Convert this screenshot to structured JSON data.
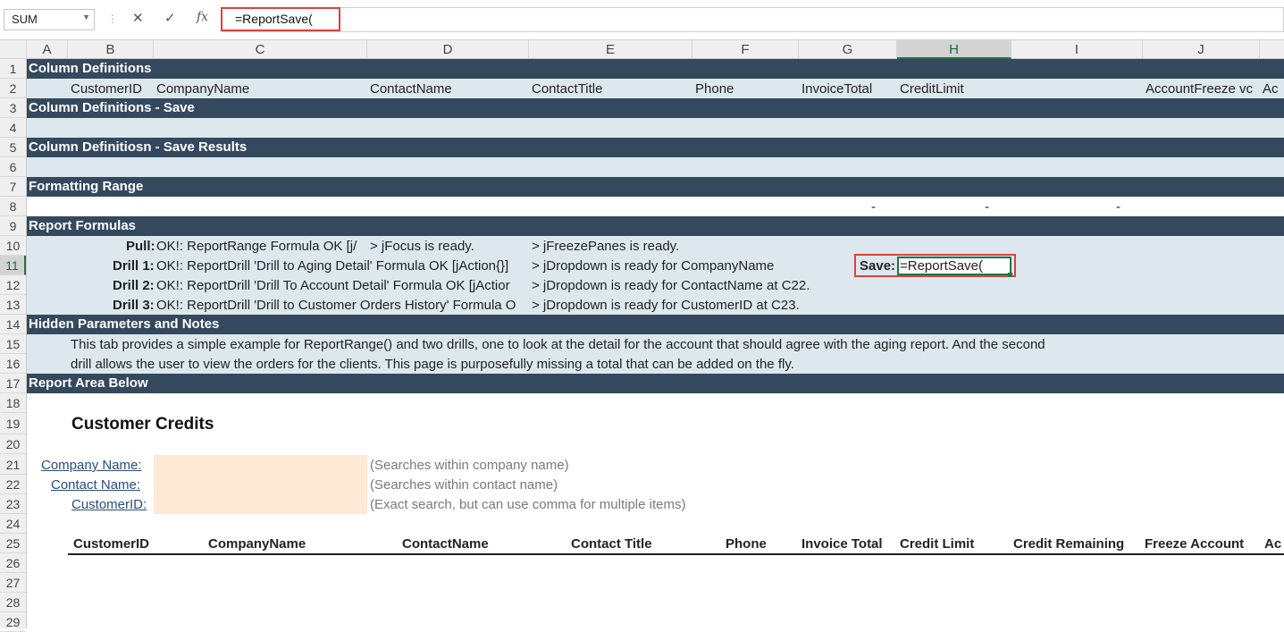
{
  "formula_bar": {
    "name_box": "SUM",
    "formula": "=ReportSave(",
    "icons": [
      "cancel-icon",
      "enter-check-icon",
      "insert-function-icon"
    ]
  },
  "columns": [
    "A",
    "B",
    "C",
    "D",
    "E",
    "F",
    "G",
    "H",
    "I",
    "J"
  ],
  "selected_column": "H",
  "rows": [
    "1",
    "2",
    "3",
    "4",
    "5",
    "6",
    "7",
    "8",
    "9",
    "10",
    "11",
    "12",
    "13",
    "14",
    "15",
    "16",
    "17",
    "18",
    "19",
    "20",
    "21",
    "22",
    "23",
    "24",
    "25",
    "26",
    "27",
    "28",
    "29"
  ],
  "selected_row": "11",
  "sections": {
    "col_defs": "Column Definitions",
    "col_defs_save": "Column Definitions - Save",
    "col_defs_save_results": "Column Definitiosn - Save Results",
    "formatting_range": "Formatting Range",
    "report_formulas": "Report Formulas",
    "hidden_params": "Hidden Parameters and Notes",
    "report_area": "Report Area Below"
  },
  "col_def_headers": {
    "b": "CustomerID",
    "c": "CompanyName",
    "d": "ContactName",
    "e": "ContactTitle",
    "f": "Phone",
    "g": "InvoiceTotal",
    "h": "CreditLimit",
    "j": "AccountFreeze vc",
    "k": "Ac"
  },
  "formatting_row": {
    "g": "-",
    "h": "-",
    "i": "-"
  },
  "formulas": {
    "pull_label": "Pull:",
    "pull_c": "OK!: ReportRange Formula OK [j/",
    "pull_d": "> jFocus is ready.",
    "pull_e": "> jFreezePanes is ready.",
    "drill1_label": "Drill 1:",
    "drill1_c": "OK!: ReportDrill 'Drill to Aging Detail' Formula OK [jAction{}]",
    "drill1_e": "> jDropdown is ready for CompanyName",
    "drill2_label": "Drill 2:",
    "drill2_c": "OK!: ReportDrill 'Drill To Account Detail' Formula OK [jActior",
    "drill2_e": "> jDropdown is ready for ContactName at C22.",
    "drill3_label": "Drill 3:",
    "drill3_c": "OK!: ReportDrill 'Drill to Customer Orders History' Formula O",
    "drill3_e": "> jDropdown is ready for CustomerID at C23.",
    "save_label": "Save:",
    "save_value": "=ReportSave("
  },
  "notes": {
    "line1": "This tab provides a simple example for ReportRange() and two drills, one to look at the detail for the account that should agree with the aging report. And the second",
    "line2": "drill allows the user to view the orders for the clients.   This page is purposefully missing a total that can be added on the fly."
  },
  "report": {
    "title": "Customer Credits",
    "filters": [
      {
        "label": "Company Name:",
        "hint": "(Searches within company name)"
      },
      {
        "label": "Contact Name:",
        "hint": "(Searches within contact name)"
      },
      {
        "label": "CustomerID:",
        "hint": "(Exact search, but can use comma for multiple items)"
      }
    ],
    "table_headers": [
      "CustomerID",
      "CompanyName",
      "ContactName",
      "Contact Title",
      "Phone",
      "Invoice Total",
      "Credit Limit",
      "Credit Remaining",
      "Freeze Account",
      "Ac"
    ]
  },
  "colors": {
    "section_band": "#34495e",
    "light_band": "#dde8ee",
    "input_fill": "#fde9d6",
    "highlight_box": "#d9433b",
    "selection": "#217346"
  }
}
